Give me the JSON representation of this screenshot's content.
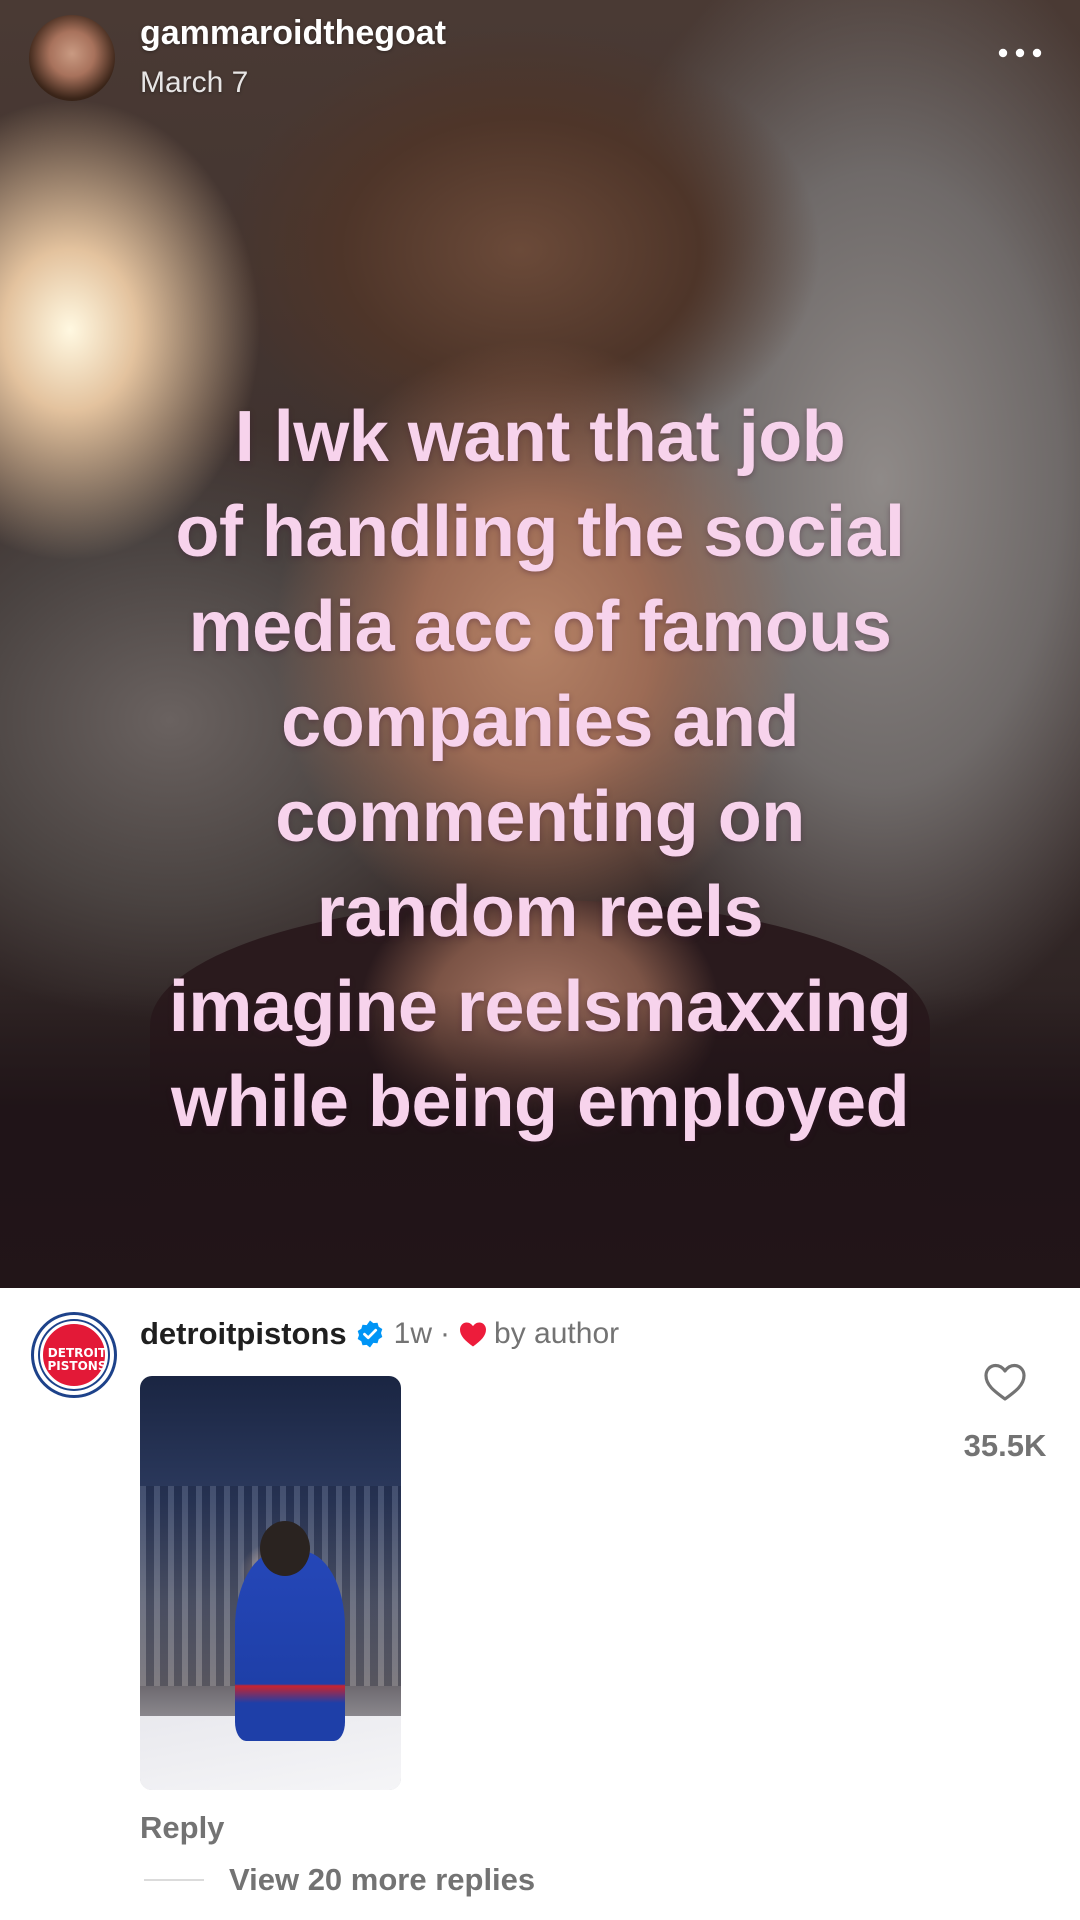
{
  "post": {
    "username": "gammaroidthegoat",
    "date": "March 7",
    "caption_lines": [
      "I lwk want that job",
      "of handling the social",
      "media acc of famous",
      "companies and",
      "commenting on",
      "random reels",
      "imagine reelsmaxxing",
      "while being employed"
    ],
    "more_icon": "more-horizontal-icon"
  },
  "comment": {
    "username": "detroitpistons",
    "verified_icon": "verified-badge-icon",
    "time": "1w",
    "separator": "·",
    "liked_by_author_icon": "heart-filled-icon",
    "liked_by_author_label": "by author",
    "avatar_logo_text": "DETROIT PISTONS",
    "reply_label": "Reply",
    "like_icon": "heart-outline-icon",
    "like_count": "35.5K",
    "view_replies_label": "View 20 more replies",
    "colors": {
      "accent_red": "#e31937",
      "verified_blue": "#0095f6",
      "secondary_text": "#737373"
    }
  }
}
